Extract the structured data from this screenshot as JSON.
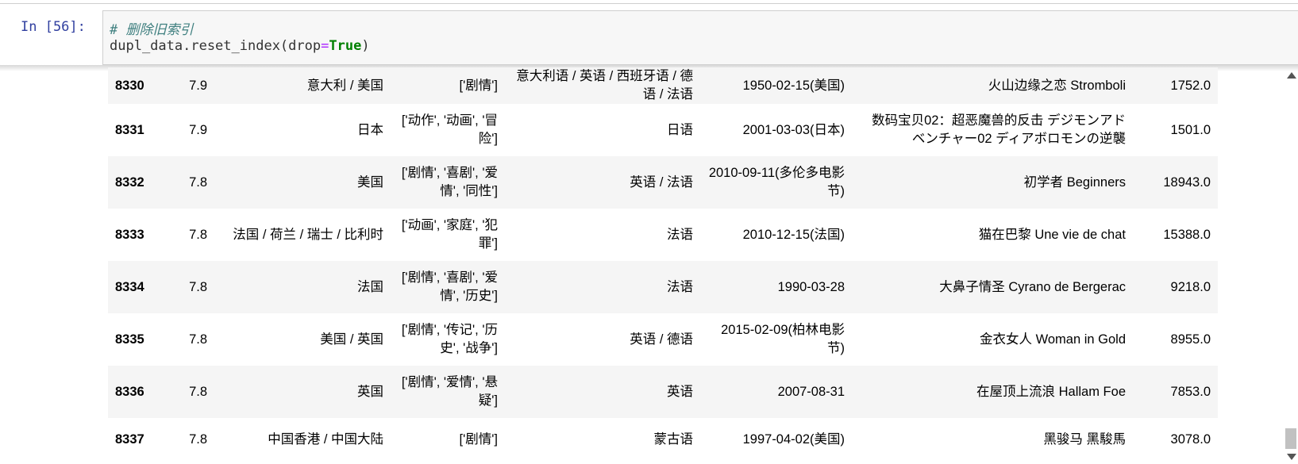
{
  "cell": {
    "prompt": "In  [56]:",
    "comment": "# 删除旧索引",
    "code_prefix": "dupl_data.reset_index(drop",
    "code_op": "=",
    "code_kw": "True",
    "code_suffix": ")"
  },
  "table": {
    "rows": [
      {
        "index": "8330",
        "rating": "7.9",
        "region": "意大利 / 美国",
        "genres": "['剧情']",
        "language": "意大利语 / 英语 / 西班牙语 / 德语 / 法语",
        "release": "1950-02-15(美国)",
        "title": "火山边缘之恋 Stromboli",
        "votes": "1752.0"
      },
      {
        "index": "8331",
        "rating": "7.9",
        "region": "日本",
        "genres": "['动作', '动画', '冒险']",
        "language": "日语",
        "release": "2001-03-03(日本)",
        "title": "数码宝贝02：超恶魔兽的反击 デジモンアドベンチャー02 ディアボロモンの逆襲",
        "votes": "1501.0"
      },
      {
        "index": "8332",
        "rating": "7.8",
        "region": "美国",
        "genres": "['剧情', '喜剧', '爱情', '同性']",
        "language": "英语 / 法语",
        "release": "2010-09-11(多伦多电影节)",
        "title": "初学者 Beginners",
        "votes": "18943.0"
      },
      {
        "index": "8333",
        "rating": "7.8",
        "region": "法国 / 荷兰 / 瑞士 / 比利时",
        "genres": "['动画', '家庭', '犯罪']",
        "language": "法语",
        "release": "2010-12-15(法国)",
        "title": "猫在巴黎 Une vie de chat",
        "votes": "15388.0"
      },
      {
        "index": "8334",
        "rating": "7.8",
        "region": "法国",
        "genres": "['剧情', '喜剧', '爱情', '历史']",
        "language": "法语",
        "release": "1990-03-28",
        "title": "大鼻子情圣 Cyrano de Bergerac",
        "votes": "9218.0"
      },
      {
        "index": "8335",
        "rating": "7.8",
        "region": "美国 / 英国",
        "genres": "['剧情', '传记', '历史', '战争']",
        "language": "英语 / 德语",
        "release": "2015-02-09(柏林电影节)",
        "title": "金衣女人 Woman in Gold",
        "votes": "8955.0"
      },
      {
        "index": "8336",
        "rating": "7.8",
        "region": "英国",
        "genres": "['剧情', '爱情', '悬疑']",
        "language": "英语",
        "release": "2007-08-31",
        "title": "在屋顶上流浪 Hallam Foe",
        "votes": "7853.0"
      },
      {
        "index": "8337",
        "rating": "7.8",
        "region": "中国香港 / 中国大陆",
        "genres": "['剧情']",
        "language": "蒙古语",
        "release": "1997-04-02(美国)",
        "title": "黑骏马 黑駿馬",
        "votes": "3078.0"
      }
    ]
  }
}
